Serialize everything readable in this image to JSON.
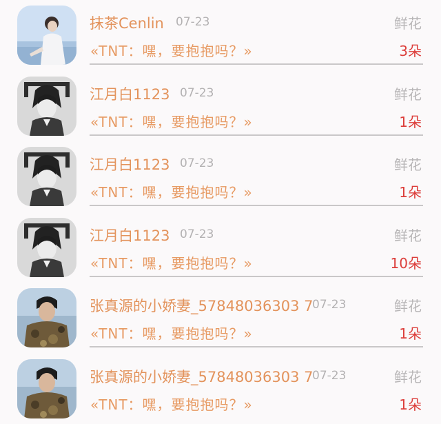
{
  "gifts": [
    {
      "user": "抹茶Cenlin",
      "date": "07-23",
      "gift": "鲜花",
      "message": "«TNT：嘿，要抱抱吗？»",
      "count": "3朵",
      "avatar_icon": "seaside-boy-avatar"
    },
    {
      "user": "江月白1123",
      "date": "07-23",
      "gift": "鲜花",
      "message": "«TNT：嘿，要抱抱吗？»",
      "count": "1朵",
      "avatar_icon": "sketch-boy-avatar"
    },
    {
      "user": "江月白1123",
      "date": "07-23",
      "gift": "鲜花",
      "message": "«TNT：嘿，要抱抱吗？»",
      "count": "1朵",
      "avatar_icon": "sketch-boy-avatar"
    },
    {
      "user": "江月白1123",
      "date": "07-23",
      "gift": "鲜花",
      "message": "«TNT：嘿，要抱抱吗？»",
      "count": "10朵",
      "avatar_icon": "sketch-boy-avatar"
    },
    {
      "user": "张真源的小娇妻_57848036303 7",
      "date": "07-23",
      "gift": "鲜花",
      "message": "«TNT：嘿，要抱抱吗？»",
      "count": "1朵",
      "avatar_icon": "camo-boy-avatar"
    },
    {
      "user": "张真源的小娇妻_57848036303 7",
      "date": "07-23",
      "gift": "鲜花",
      "message": "«TNT：嘿，要抱抱吗？»",
      "count": "1朵",
      "avatar_icon": "camo-boy-avatar"
    }
  ],
  "colors": {
    "background": "#fbf9fa",
    "username": "#e3935c",
    "message": "#e79a63",
    "count": "#dc3d3a",
    "muted": "#b4b2b3"
  }
}
